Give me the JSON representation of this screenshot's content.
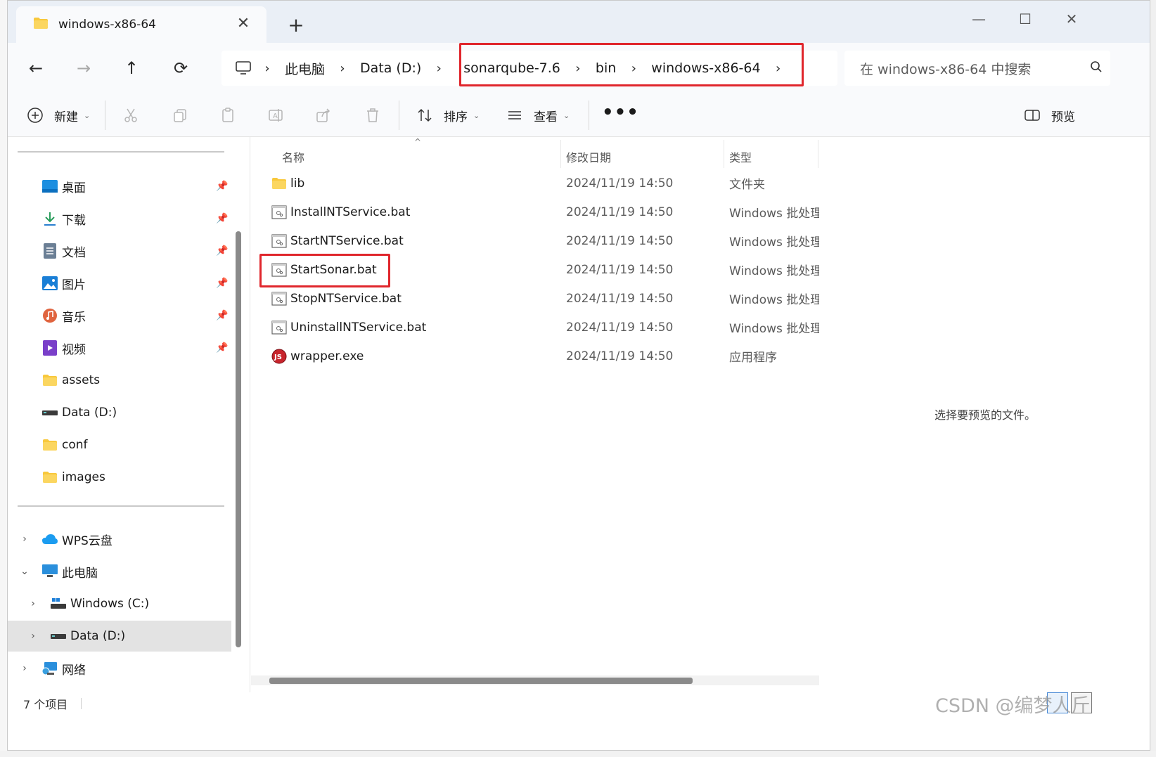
{
  "window": {
    "tab_title": "windows-x86-64",
    "new_tab": "+",
    "close_tab": "✕",
    "minimize": "—",
    "maximize": "☐",
    "close": "✕"
  },
  "nav": {
    "back": "←",
    "forward": "→",
    "up": "↑",
    "refresh": "⟳"
  },
  "breadcrumb": [
    {
      "label": "此电脑"
    },
    {
      "label": "Data (D:)"
    },
    {
      "label": "sonarqube-7.6"
    },
    {
      "label": "bin"
    },
    {
      "label": "windows-x86-64"
    }
  ],
  "search": {
    "placeholder": "在 windows-x86-64 中搜索"
  },
  "toolbar": {
    "new_label": "新建",
    "sort_label": "排序",
    "view_label": "查看",
    "more_label": "•••",
    "preview_label": "预览"
  },
  "sidebar": {
    "quick_access": [
      {
        "label": "桌面",
        "icon": "desktop-icon",
        "pinned": true
      },
      {
        "label": "下载",
        "icon": "download-icon",
        "pinned": true
      },
      {
        "label": "文档",
        "icon": "document-icon",
        "pinned": true
      },
      {
        "label": "图片",
        "icon": "pictures-icon",
        "pinned": true
      },
      {
        "label": "音乐",
        "icon": "music-icon",
        "pinned": true
      },
      {
        "label": "视频",
        "icon": "video-icon",
        "pinned": true
      },
      {
        "label": "assets",
        "icon": "folder-icon",
        "pinned": false
      },
      {
        "label": "Data (D:)",
        "icon": "drive-icon",
        "pinned": false
      },
      {
        "label": "conf",
        "icon": "folder-icon",
        "pinned": false
      },
      {
        "label": "images",
        "icon": "folder-icon",
        "pinned": false
      }
    ],
    "tree": [
      {
        "label": "WPS云盘",
        "icon": "cloud-icon",
        "expander": "›",
        "level": 0
      },
      {
        "label": "此电脑",
        "icon": "computer-icon",
        "expander": "⌄",
        "level": 0
      },
      {
        "label": "Windows (C:)",
        "icon": "windows-drive-icon",
        "expander": "›",
        "level": 1
      },
      {
        "label": "Data (D:)",
        "icon": "drive-icon",
        "expander": "›",
        "level": 1,
        "selected": true
      },
      {
        "label": "网络",
        "icon": "network-icon",
        "expander": "›",
        "level": 0
      }
    ]
  },
  "file_list": {
    "columns": [
      "名称",
      "修改日期",
      "类型"
    ],
    "rows": [
      {
        "name": "lib",
        "date": "2024/11/19 14:50",
        "type": "文件夹",
        "icon": "folder-icon"
      },
      {
        "name": "InstallNTService.bat",
        "date": "2024/11/19 14:50",
        "type": "Windows 批处理",
        "icon": "batch-file-icon"
      },
      {
        "name": "StartNTService.bat",
        "date": "2024/11/19 14:50",
        "type": "Windows 批处理",
        "icon": "batch-file-icon"
      },
      {
        "name": "StartSonar.bat",
        "date": "2024/11/19 14:50",
        "type": "Windows 批处理",
        "icon": "batch-file-icon"
      },
      {
        "name": "StopNTService.bat",
        "date": "2024/11/19 14:50",
        "type": "Windows 批处理",
        "icon": "batch-file-icon"
      },
      {
        "name": "UninstallNTService.bat",
        "date": "2024/11/19 14:50",
        "type": "Windows 批处理",
        "icon": "batch-file-icon"
      },
      {
        "name": "wrapper.exe",
        "date": "2024/11/19 14:50",
        "type": "应用程序",
        "icon": "app-exe-icon"
      }
    ]
  },
  "preview": {
    "message": "选择要预览的文件。"
  },
  "status": {
    "item_count": "7 个项目"
  },
  "watermark": "CSDN @编梦人斤",
  "colors": {
    "highlight": "#e0262c",
    "folder": "#f8c83c",
    "accent": "#0067c0"
  }
}
